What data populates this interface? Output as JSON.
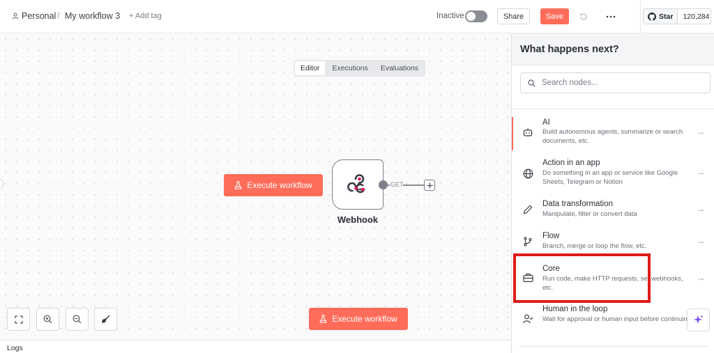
{
  "header": {
    "breadcrumb_personal": "Personal",
    "breadcrumb_sep": "/",
    "workflow_name": "My workflow 3",
    "add_tag": "+ Add tag",
    "status_label": "Inactive",
    "share_label": "Share",
    "save_label": "Save",
    "github_star": "Star",
    "github_count": "120,284"
  },
  "canvas_tabs": [
    "Editor",
    "Executions",
    "Evaluations"
  ],
  "canvas": {
    "execute_top": "Execute workflow",
    "execute_bottom": "Execute workflow",
    "node_label": "Webhook",
    "connector_label": "GET"
  },
  "logs_label": "Logs",
  "panel": {
    "title": "What happens next?",
    "search_placeholder": "Search nodes...",
    "items": [
      {
        "title": "AI",
        "desc": "Build autonomous agents, summarize or search documents, etc.",
        "icon": "robot-icon"
      },
      {
        "title": "Action in an app",
        "desc": "Do something in an app or service like Google Sheets, Telegram or Notion",
        "icon": "globe-icon"
      },
      {
        "title": "Data transformation",
        "desc": "Manipulate, filter or convert data",
        "icon": "pen-icon"
      },
      {
        "title": "Flow",
        "desc": "Branch, merge or loop the flow, etc.",
        "icon": "branch-icon"
      },
      {
        "title": "Core",
        "desc": "Run code, make HTTP requests, set webhooks, etc.",
        "icon": "briefcase-icon"
      },
      {
        "title": "Human in the loop",
        "desc": "Wait for approval or human input before continuing",
        "icon": "user-check-icon"
      }
    ]
  },
  "colors": {
    "accent": "#ff6d5a",
    "highlight": "#e01a1a"
  }
}
